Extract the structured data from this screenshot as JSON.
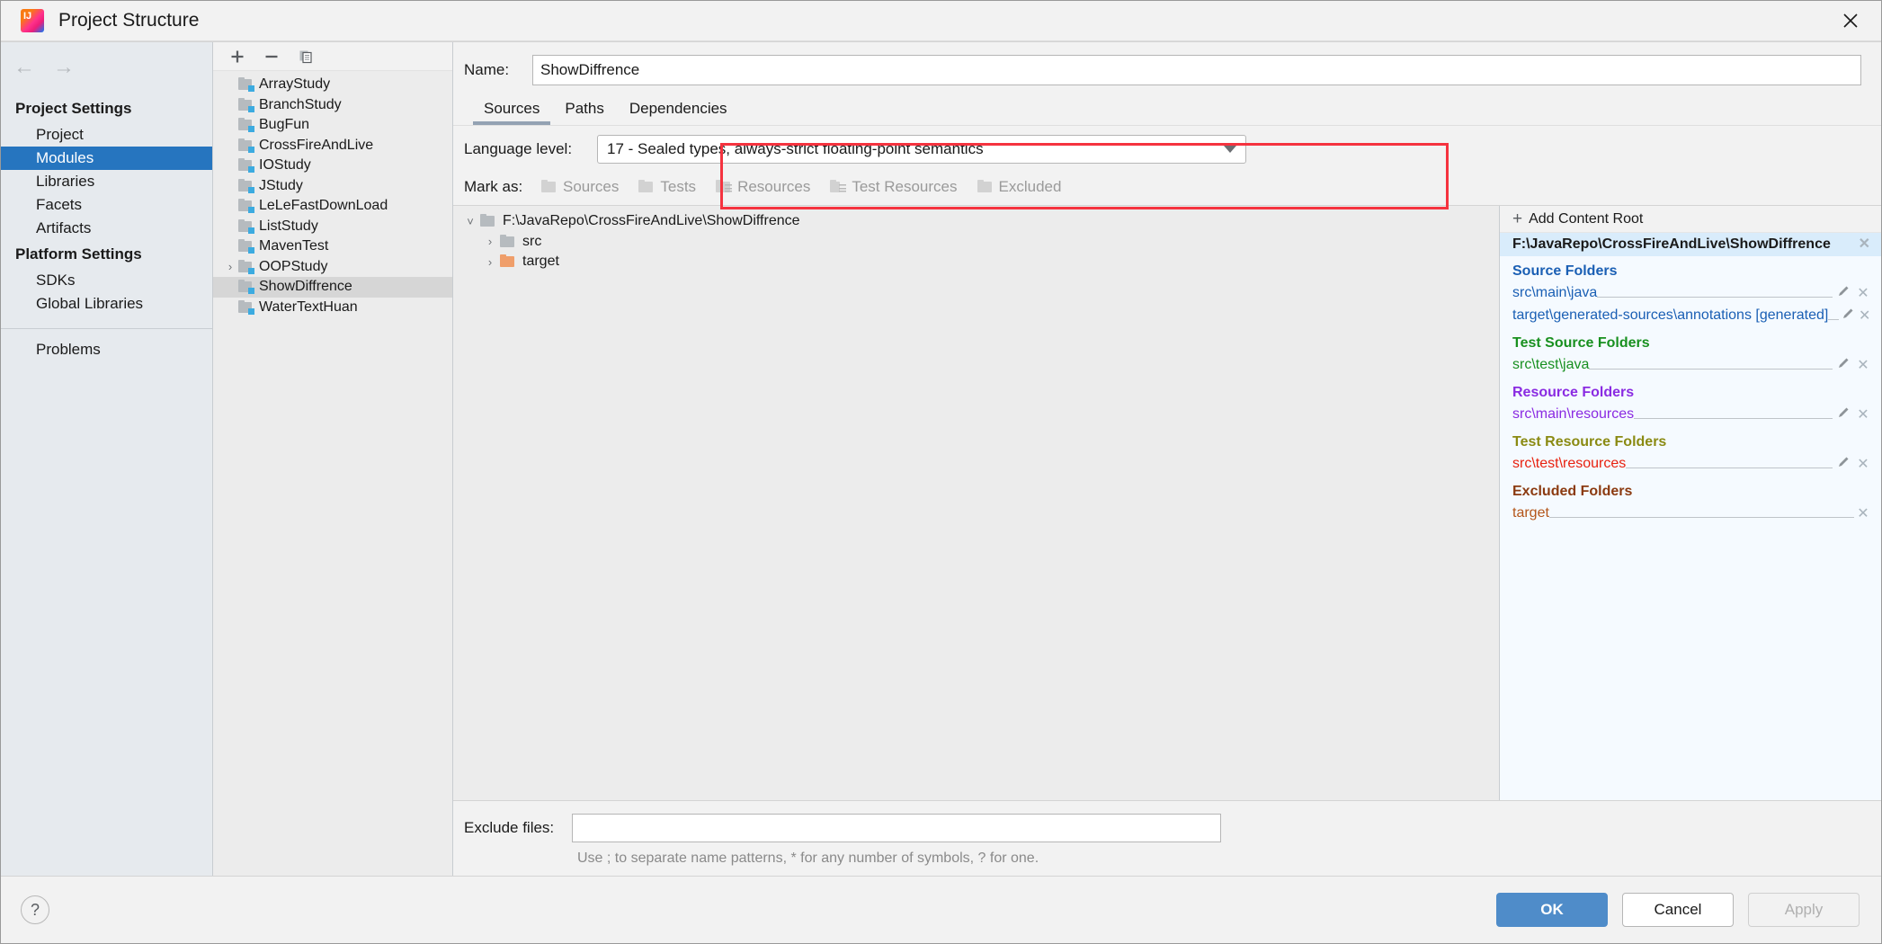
{
  "window": {
    "title": "Project Structure",
    "logo_icon": "intellij-idea-logo",
    "close_icon": "close-icon"
  },
  "left_nav": {
    "back_icon": "arrow-left-icon",
    "forward_icon": "arrow-right-icon",
    "groups": [
      {
        "title": "Project Settings",
        "items": [
          {
            "label": "Project",
            "selected": false
          },
          {
            "label": "Modules",
            "selected": true
          },
          {
            "label": "Libraries",
            "selected": false
          },
          {
            "label": "Facets",
            "selected": false
          },
          {
            "label": "Artifacts",
            "selected": false
          }
        ]
      },
      {
        "title": "Platform Settings",
        "items": [
          {
            "label": "SDKs",
            "selected": false
          },
          {
            "label": "Global Libraries",
            "selected": false
          }
        ]
      }
    ],
    "problems": {
      "label": "Problems",
      "selected": false
    }
  },
  "modules_panel": {
    "toolbar": {
      "add_icon": "plus-icon",
      "remove_icon": "minus-icon",
      "copy_icon": "copy-icon"
    },
    "items": [
      {
        "label": "ArrayStudy",
        "expandable": false,
        "selected": false
      },
      {
        "label": "BranchStudy",
        "expandable": false,
        "selected": false
      },
      {
        "label": "BugFun",
        "expandable": false,
        "selected": false
      },
      {
        "label": "CrossFireAndLive",
        "expandable": false,
        "selected": false
      },
      {
        "label": "IOStudy",
        "expandable": false,
        "selected": false
      },
      {
        "label": "JStudy",
        "expandable": false,
        "selected": false
      },
      {
        "label": "LeLeFastDownLoad",
        "expandable": false,
        "selected": false
      },
      {
        "label": "ListStudy",
        "expandable": false,
        "selected": false
      },
      {
        "label": "MavenTest",
        "expandable": false,
        "selected": false
      },
      {
        "label": "OOPStudy",
        "expandable": true,
        "selected": false
      },
      {
        "label": "ShowDiffrence",
        "expandable": false,
        "selected": true
      },
      {
        "label": "WaterTextHuan",
        "expandable": false,
        "selected": false
      }
    ]
  },
  "module_editor": {
    "name_label": "Name:",
    "name_value": "ShowDiffrence",
    "tabs": [
      {
        "label": "Sources",
        "active": true
      },
      {
        "label": "Paths",
        "active": false
      },
      {
        "label": "Dependencies",
        "active": false
      }
    ],
    "language_level": {
      "label": "Language level:",
      "value": "17 - Sealed types, always-strict floating-point semantics",
      "dropdown_icon": "chevron-down-icon"
    },
    "mark_as": {
      "label": "Mark as:",
      "buttons": [
        {
          "label": "Sources",
          "mnemonic": "S",
          "icon": "folder-sources-icon"
        },
        {
          "label": "Tests",
          "mnemonic": "T",
          "icon": "folder-tests-icon"
        },
        {
          "label": "Resources",
          "mnemonic": "R",
          "icon": "folder-resources-icon"
        },
        {
          "label": "Test Resources",
          "mnemonic": "",
          "icon": "folder-test-resources-icon"
        },
        {
          "label": "Excluded",
          "mnemonic": "E",
          "icon": "folder-excluded-icon"
        }
      ]
    },
    "tree": [
      {
        "label": "F:\\JavaRepo\\CrossFireAndLive\\ShowDiffrence",
        "indent": 0,
        "state": "expanded",
        "color": "grey"
      },
      {
        "label": "src",
        "indent": 1,
        "state": "collapsed",
        "color": "grey"
      },
      {
        "label": "target",
        "indent": 1,
        "state": "collapsed",
        "color": "orange"
      }
    ],
    "exclude_files": {
      "label": "Exclude files:",
      "value": "",
      "hint": "Use ; to separate name patterns, * for any number of symbols, ? for one."
    }
  },
  "content_roots": {
    "add_label": "Add Content Root",
    "add_mnemonic": "C",
    "add_icon": "plus-icon",
    "root_path": "F:\\JavaRepo\\CrossFireAndLive\\ShowDiffrence",
    "root_remove_icon": "close-icon",
    "groups": [
      {
        "title": "Source Folders",
        "color": "#1a5fb4",
        "entries": [
          {
            "path": "src\\main\\java",
            "editable": true,
            "removable": true
          },
          {
            "path": "target\\generated-sources\\annotations [generated]",
            "editable": true,
            "removable": true
          }
        ]
      },
      {
        "title": "Test Source Folders",
        "color": "#18901f",
        "entries": [
          {
            "path": "src\\test\\java",
            "editable": true,
            "removable": true
          }
        ]
      },
      {
        "title": "Resource Folders",
        "color": "#8a2be2",
        "entries": [
          {
            "path": "src\\main\\resources",
            "editable": true,
            "removable": true
          }
        ]
      },
      {
        "title": "Test Resource Folders",
        "color": "#8a8a12",
        "entries": [
          {
            "path": "src\\test\\resources",
            "editable": true,
            "removable": true,
            "path_color": "#e8210f"
          }
        ]
      },
      {
        "title": "Excluded Folders",
        "color": "#8b3a10",
        "entries": [
          {
            "path": "target",
            "editable": false,
            "removable": true,
            "path_color": "#b4561a"
          }
        ]
      }
    ]
  },
  "footer": {
    "help_label": "?",
    "help_icon": "question-mark-icon",
    "ok_label": "OK",
    "cancel_label": "Cancel",
    "apply_label": "Apply",
    "apply_disabled": true
  },
  "annotation": {
    "highlight_color": "#f5333f",
    "note": "red rectangle around Language level row"
  },
  "colors": {
    "selection_blue": "#2675bf",
    "primary_button": "#4f8cc9",
    "roots_background": "#f5faff",
    "root_header": "#d9ecfb"
  }
}
